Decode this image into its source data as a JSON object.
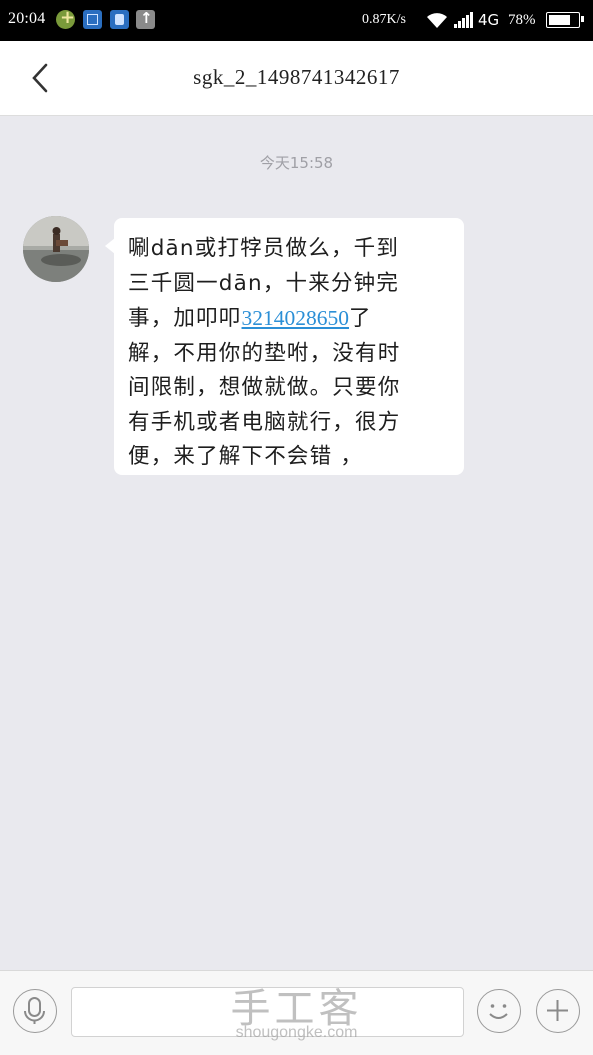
{
  "status_bar": {
    "time": "20:04",
    "net_speed": "0.87K/s",
    "network": "4G",
    "battery_percent": "78%",
    "battery_level": 0.78
  },
  "header": {
    "title": "sgk_2_1498741342617"
  },
  "chat": {
    "time_separator": "今天15:58",
    "message": {
      "lines": [
        "唰dān或打牸员做么，千到",
        "三千圆一dān，十来分钟完",
        "事，加叩叩",
        "解，不用你的垫咐，没有时",
        "间限制，想做就做。只要你",
        "有手机或者电脑就行，很方",
        "便，来了解下不会错 ，"
      ],
      "phone_link": "3214028650",
      "line3_suffix": "了"
    }
  },
  "watermark": {
    "chinese": "手工客",
    "english": "shougongke.com"
  },
  "icons": [
    "back-arrow-icon",
    "microphone-icon",
    "smiley-icon",
    "plus-icon",
    "wifi-icon",
    "signal-icon",
    "battery-icon"
  ]
}
